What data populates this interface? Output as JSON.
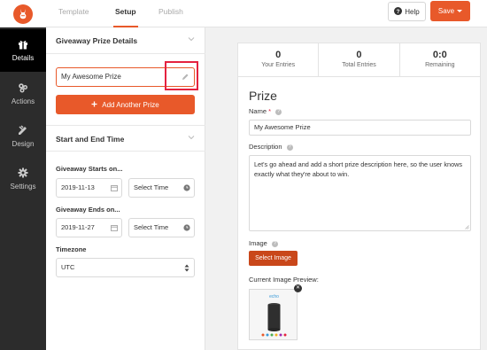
{
  "header": {
    "tabs": [
      {
        "label": "Template",
        "active": false
      },
      {
        "label": "Setup",
        "active": true
      },
      {
        "label": "Publish",
        "active": false
      }
    ],
    "help_label": "Help",
    "save_label": "Save"
  },
  "sidebar": {
    "items": [
      {
        "label": "Details",
        "icon": "gift-icon",
        "active": true
      },
      {
        "label": "Actions",
        "icon": "actions-icon",
        "active": false
      },
      {
        "label": "Design",
        "icon": "design-icon",
        "active": false
      },
      {
        "label": "Settings",
        "icon": "gear-icon",
        "active": false
      }
    ]
  },
  "panel": {
    "prize_section_title": "Giveaway Prize Details",
    "prize_name": "My Awesome Prize",
    "add_prize_label": "Add Another Prize",
    "time_section_title": "Start and End Time",
    "starts_label": "Giveaway Starts on...",
    "start_date": "2019-11-13",
    "start_time_placeholder": "Select Time",
    "ends_label": "Giveaway Ends on...",
    "end_date": "2019-11-27",
    "end_time_placeholder": "Select Time",
    "timezone_label": "Timezone",
    "timezone_value": "UTC"
  },
  "preview": {
    "stats": [
      {
        "value": "0",
        "caption": "Your Entries"
      },
      {
        "value": "0",
        "caption": "Total Entries"
      },
      {
        "value": "0:0",
        "caption": "Remaining"
      }
    ],
    "title": "Prize",
    "name_label": "Name",
    "name_required": "*",
    "name_value": "My Awesome Prize",
    "description_label": "Description",
    "description_value": "Let's go ahead and add a short prize description here, so the user knows exactly what they're about to win.",
    "image_label": "Image",
    "select_image_label": "Select Image",
    "current_image_label": "Current Image Preview:",
    "thumb_brand": "echo"
  },
  "colors": {
    "accent": "#e8592a",
    "highlight": "#e4223f",
    "sidebar_bg": "#2c2c2c"
  }
}
